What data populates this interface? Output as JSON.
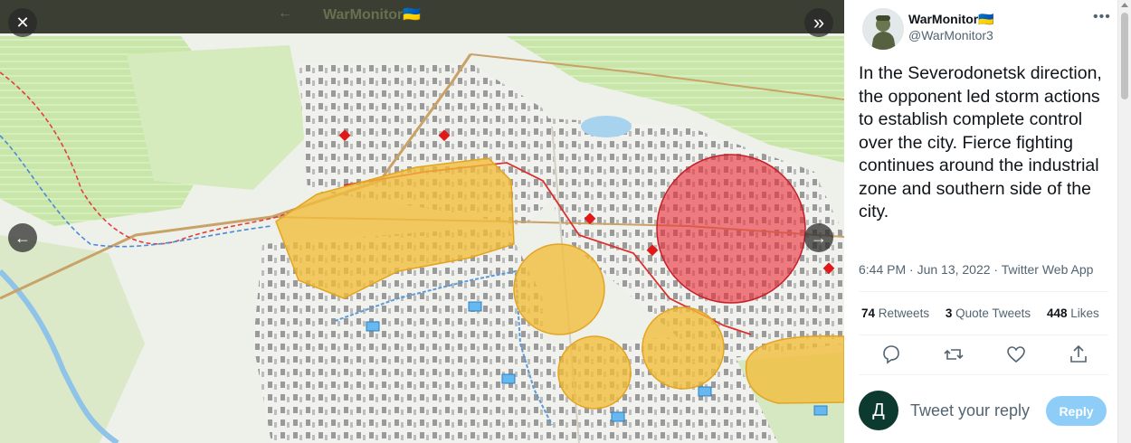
{
  "media": {
    "top_bar": {
      "title": "WarMonitor🇺🇦",
      "back_arrow": "←"
    },
    "close_icon": "✕",
    "expand_icon": "»",
    "prev_icon": "←",
    "next_icon": "→",
    "colors": {
      "overlay_bar": "#3a3e33",
      "red_zone": "#e8303a",
      "yellow_zone": "#f2bc38",
      "forest": "#c8e6a8"
    }
  },
  "tweet": {
    "display_name": "WarMonitor🇺🇦",
    "handle": "@WarMonitor3",
    "more_icon": "•••",
    "text": "In the Severodonetsk direction, the opponent led storm actions to establish complete control over the city. Fierce fighting continues around the industrial zone and southern side of the city.",
    "timestamp": "6:44 PM · Jun 13, 2022 · Twitter Web App",
    "stats": {
      "retweets_count": "74",
      "retweets_label": "Retweets",
      "quotes_count": "3",
      "quotes_label": "Quote Tweets",
      "likes_count": "448",
      "likes_label": "Likes"
    },
    "actions": [
      "reply-icon",
      "retweet-icon",
      "like-icon",
      "share-icon"
    ]
  },
  "reply_box": {
    "avatar_letter": "Д",
    "placeholder": "Tweet your reply",
    "button_label": "Reply",
    "colors": {
      "avatar": "#0d3a2f",
      "button": "#8ecdf8"
    }
  }
}
